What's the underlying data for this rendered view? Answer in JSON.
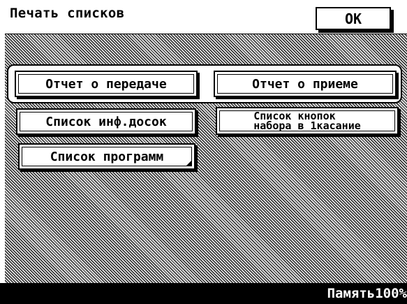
{
  "header": {
    "title": "Печать списков",
    "ok_label": "OK"
  },
  "buttons": {
    "transmission_report": "Отчет о передаче",
    "reception_report": "Отчет о приеме",
    "board_info_list": "Список инф.досок",
    "one_touch_line1": "Список кнопок",
    "one_touch_line2": "набора в 1касание",
    "program_list": "Список программ"
  },
  "status": {
    "memory": "Память100%"
  }
}
